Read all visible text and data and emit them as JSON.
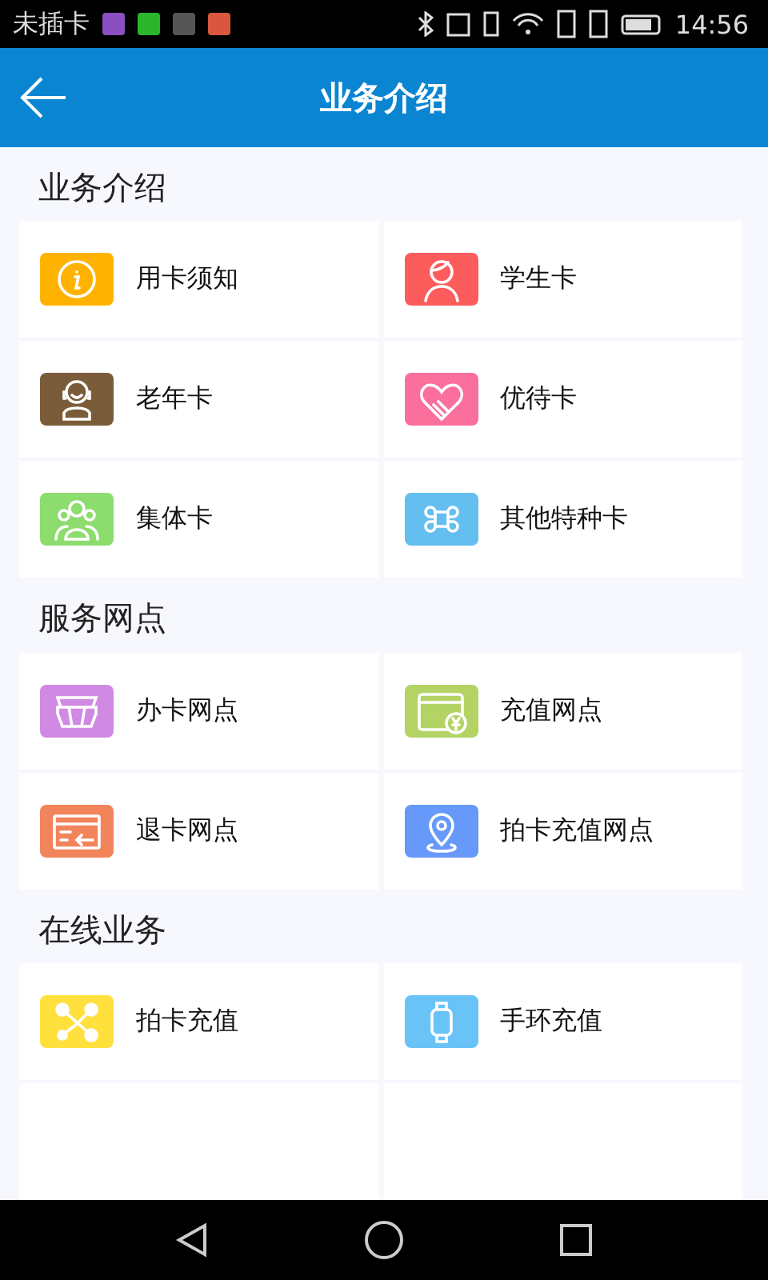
{
  "status_bar": {
    "carrier": "未插卡",
    "time": "14:56"
  },
  "header": {
    "title": "业务介绍"
  },
  "sections": [
    {
      "title": "业务介绍",
      "items": [
        {
          "label": "用卡须知",
          "color": "#ffb300"
        },
        {
          "label": "学生卡",
          "color": "#fd5c5c"
        },
        {
          "label": "老年卡",
          "color": "#7a5c3a"
        },
        {
          "label": "优待卡",
          "color": "#fb6f9c"
        },
        {
          "label": "集体卡",
          "color": "#8ddc6e"
        },
        {
          "label": "其他特种卡",
          "color": "#64bef0"
        }
      ]
    },
    {
      "title": "服务网点",
      "items": [
        {
          "label": "办卡网点",
          "color": "#d08ae3"
        },
        {
          "label": "充值网点",
          "color": "#b3d365"
        },
        {
          "label": "退卡网点",
          "color": "#f2845c"
        },
        {
          "label": "拍卡充值网点",
          "color": "#6699f9"
        }
      ]
    },
    {
      "title": "在线业务",
      "items": [
        {
          "label": "拍卡充值",
          "color": "#ffe03d"
        },
        {
          "label": "手环充值",
          "color": "#6ac3f6"
        }
      ]
    }
  ]
}
